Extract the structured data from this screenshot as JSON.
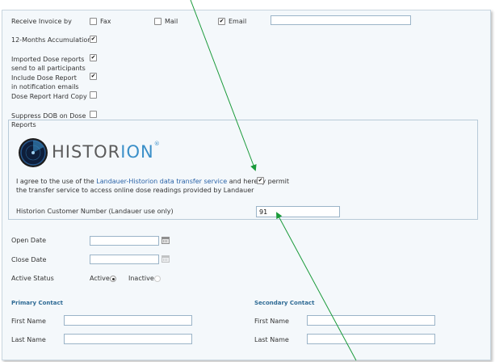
{
  "receive_invoice": {
    "label": "Receive Invoice by",
    "options": [
      {
        "label": "Fax",
        "checked": false
      },
      {
        "label": "Mail",
        "checked": false
      },
      {
        "label": "Email",
        "checked": true
      }
    ],
    "email_value": ""
  },
  "twelve_months": {
    "label": "12-Months Accumulations",
    "checked": true
  },
  "imported_dose": {
    "label_line1": "Imported Dose reports",
    "label_line2": "send to all participants",
    "checked": true
  },
  "include_dose": {
    "label_line1": "Include Dose Report",
    "label_line2": "in notification emails",
    "checked": true
  },
  "hard_copy": {
    "label": "Dose Report Hard Copy",
    "checked": false
  },
  "suppress_dob": {
    "label_line1": "Suppress DOB on Dose",
    "label_line2": "Reports",
    "checked": false
  },
  "historion": {
    "logo_main": "HISTOR",
    "logo_accent": "ION",
    "logo_mark": "®",
    "agree_prefix": "I agree to the use of the ",
    "agree_link": "Landauer-Historion data transfer service",
    "agree_suffix": " and hereby permit",
    "agree_line2": "the transfer service to access online dose readings provided by Landauer",
    "agree_checked": true,
    "customer_number_label": "Historion Customer Number (Landauer use only)",
    "customer_number_value": "91"
  },
  "open_date": {
    "label": "Open Date",
    "value": ""
  },
  "close_date": {
    "label": "Close Date",
    "value": ""
  },
  "active_status": {
    "label": "Active Status",
    "active_label": "Active",
    "inactive_label": "Inactive",
    "selected": "active"
  },
  "primary_contact": {
    "title": "Primary Contact",
    "first_name_label": "First Name",
    "last_name_label": "Last Name",
    "first_name": "",
    "last_name": ""
  },
  "secondary_contact": {
    "title": "Secondary Contact",
    "first_name_label": "First Name",
    "last_name_label": "Last Name",
    "first_name": "",
    "last_name": ""
  },
  "check_mark": "✔",
  "colors": {
    "link": "#2a63a8",
    "section": "#2f6b95",
    "arrow": "#1a9a3a",
    "border": "#9bb4c8"
  }
}
